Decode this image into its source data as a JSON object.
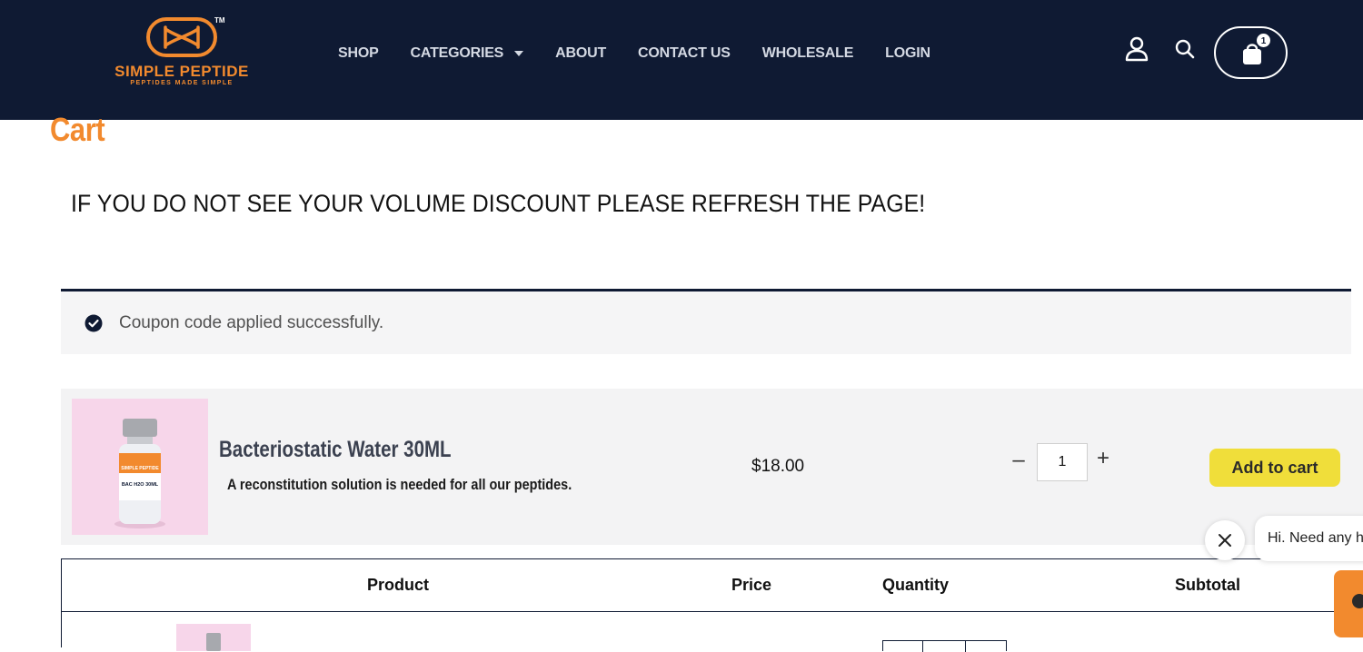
{
  "header": {
    "logo_name": "SIMPLE PEPTIDE",
    "logo_tagline": "PEPTIDES MADE SIMPLE",
    "logo_tm": "TM",
    "nav": [
      "SHOP",
      "CATEGORIES",
      "ABOUT",
      "CONTACT US",
      "WHOLESALE",
      "LOGIN"
    ],
    "cart_count": "1",
    "icons": [
      "user-icon",
      "search-icon",
      "shopping-bag-icon"
    ]
  },
  "page": {
    "title": "Cart",
    "discount_note": "IF YOU DO NOT SEE YOUR VOLUME DISCOUNT PLEASE REFRESH THE PAGE!"
  },
  "notice": {
    "text": "Coupon code applied successfully."
  },
  "upsell": {
    "product_name": "Bacteriostatic Water 30ML",
    "description": "A reconstitution solution is needed for all our peptides.",
    "price": "$18.00",
    "quantity": "1",
    "add_to_cart_label": "Add to cart",
    "image_label_brand": "SIMPLE PEPTIDE",
    "image_label_text": "BAC H2O 30ML"
  },
  "cart_table": {
    "headers": [
      "Product",
      "Price",
      "Quantity",
      "Subtotal"
    ]
  },
  "chat": {
    "bubble_text": "Hi. Need any help?"
  },
  "colors": {
    "header_bg": "#0f1a33",
    "brand_orange": "#f28a2e",
    "add_to_cart_yellow": "#f0de3a"
  }
}
